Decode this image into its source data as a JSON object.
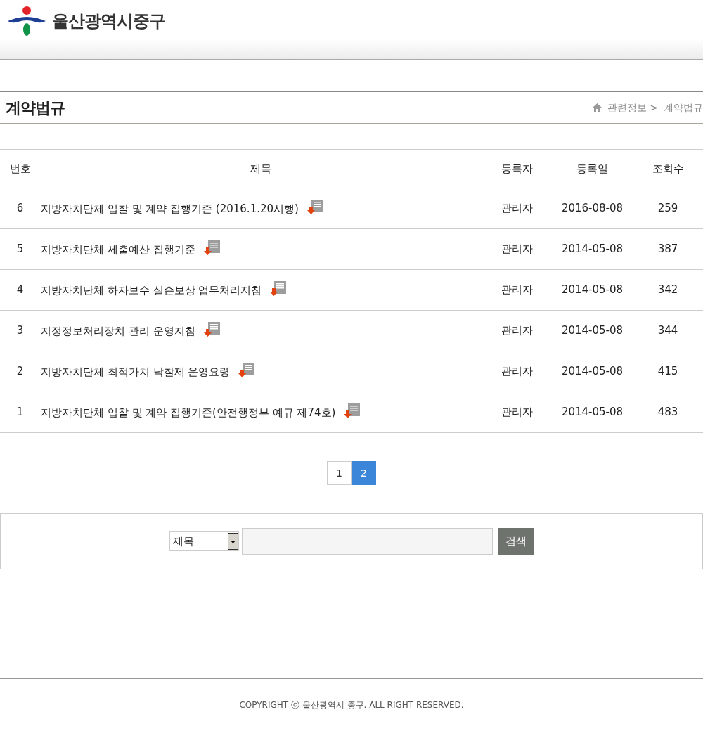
{
  "header": {
    "logo_text": "울산광역시중구"
  },
  "page_title": "계약법규",
  "breadcrumb": [
    "관련정보 >",
    "계약법규"
  ],
  "table": {
    "columns": [
      "번호",
      "제목",
      "등록자",
      "등록일",
      "조회수"
    ],
    "rows": [
      {
        "number": "6",
        "title": "지방자치단체 입찰 및 계약 집행기준 (2016.1.20시행)",
        "author": "관리자",
        "date": "2016-08-08",
        "views": "259"
      },
      {
        "number": "5",
        "title": "지방자치단체 세출예산 집행기준",
        "author": "관리자",
        "date": "2014-05-08",
        "views": "387"
      },
      {
        "number": "4",
        "title": "지방자치단체 하자보수 실손보상 업무처리지침",
        "author": "관리자",
        "date": "2014-05-08",
        "views": "342"
      },
      {
        "number": "3",
        "title": "지정정보처리장치 관리 운영지침",
        "author": "관리자",
        "date": "2014-05-08",
        "views": "344"
      },
      {
        "number": "2",
        "title": "지방자치단체 최적가치 낙찰제 운영요령",
        "author": "관리자",
        "date": "2014-05-08",
        "views": "415"
      },
      {
        "number": "1",
        "title": "지방자치단체 입찰 및 계약 집행기준(안전행정부 예규 제74호)",
        "author": "관리자",
        "date": "2014-05-08",
        "views": "483"
      }
    ]
  },
  "pagination": [
    {
      "label": "1",
      "selected": false
    },
    {
      "label": "2",
      "selected": true
    }
  ],
  "search": {
    "field": "제목",
    "button": "검색"
  },
  "footer": "COPYRIGHT ⓒ 울산광역시 중구. ALL RIGHT RESERVED."
}
